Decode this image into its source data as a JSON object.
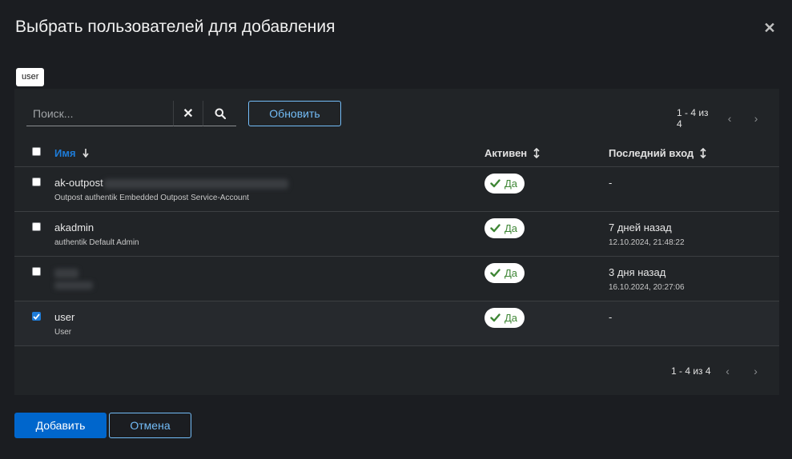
{
  "dialog": {
    "title": "Выбрать пользователей для добавления",
    "close_icon": "close-icon"
  },
  "filter_chip": {
    "label": "user"
  },
  "toolbar": {
    "search_placeholder": "Поиск...",
    "search_value": "",
    "refresh_label": "Обновить",
    "pagination": "1 - 4 из 4"
  },
  "table": {
    "columns": {
      "name": "Имя",
      "active": "Активен",
      "last_login": "Последний вход"
    },
    "rows": [
      {
        "name": "ak-outpost",
        "name_redacted": true,
        "sub": "Outpost authentik Embedded Outpost Service-Account",
        "active": "Да",
        "last_login": "-",
        "last_login_sub": "",
        "checked": false
      },
      {
        "name": "akadmin",
        "name_redacted": false,
        "sub": "authentik Default Admin",
        "active": "Да",
        "last_login": "7 дней назад",
        "last_login_sub": "12.10.2024, 21:48:22",
        "checked": false
      },
      {
        "name": "",
        "name_redacted": true,
        "sub": "",
        "active": "Да",
        "last_login": "3 дня назад",
        "last_login_sub": "16.10.2024, 20:27:06",
        "checked": false
      },
      {
        "name": "user",
        "name_redacted": false,
        "sub": "User",
        "active": "Да",
        "last_login": "-",
        "last_login_sub": "",
        "checked": true
      }
    ]
  },
  "bottom_pagination": "1 - 4 из 4",
  "actions": {
    "add_label": "Добавить",
    "cancel_label": "Отмена"
  },
  "colors": {
    "accent": "#0066cc",
    "link": "#73bcf7",
    "success": "#3e8635",
    "background": "#1b1d21",
    "panel": "#212427"
  }
}
